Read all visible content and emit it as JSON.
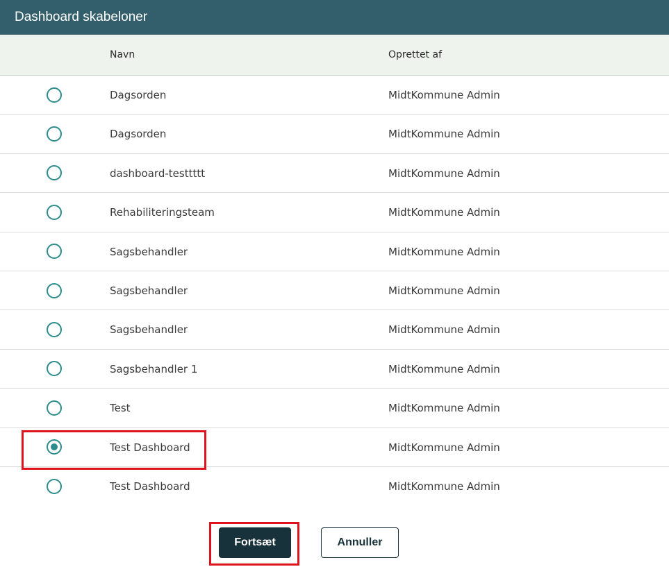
{
  "dialog": {
    "title": "Dashboard skabeloner"
  },
  "columns": {
    "name": "Navn",
    "created_by": "Oprettet af"
  },
  "rows": [
    {
      "name": "Dagsorden",
      "created_by": "MidtKommune Admin",
      "selected": false
    },
    {
      "name": "Dagsorden",
      "created_by": "MidtKommune Admin",
      "selected": false
    },
    {
      "name": "dashboard-testtttt",
      "created_by": "MidtKommune Admin",
      "selected": false
    },
    {
      "name": "Rehabiliteringsteam",
      "created_by": "MidtKommune Admin",
      "selected": false
    },
    {
      "name": "Sagsbehandler",
      "created_by": "MidtKommune Admin",
      "selected": false
    },
    {
      "name": "Sagsbehandler",
      "created_by": "MidtKommune Admin",
      "selected": false
    },
    {
      "name": "Sagsbehandler",
      "created_by": "MidtKommune Admin",
      "selected": false
    },
    {
      "name": "Sagsbehandler 1",
      "created_by": "MidtKommune Admin",
      "selected": false
    },
    {
      "name": "Test",
      "created_by": "MidtKommune Admin",
      "selected": false
    },
    {
      "name": "Test Dashboard",
      "created_by": "MidtKommune Admin",
      "selected": true
    },
    {
      "name": "Test Dashboard",
      "created_by": "MidtKommune Admin",
      "selected": false
    }
  ],
  "buttons": {
    "continue_label": "Fortsæt",
    "cancel_label": "Annuller"
  },
  "colors": {
    "header_bg": "#335f6c",
    "accent": "#2b8c8a",
    "primary_button": "#17323a",
    "highlight": "#e0121e"
  }
}
